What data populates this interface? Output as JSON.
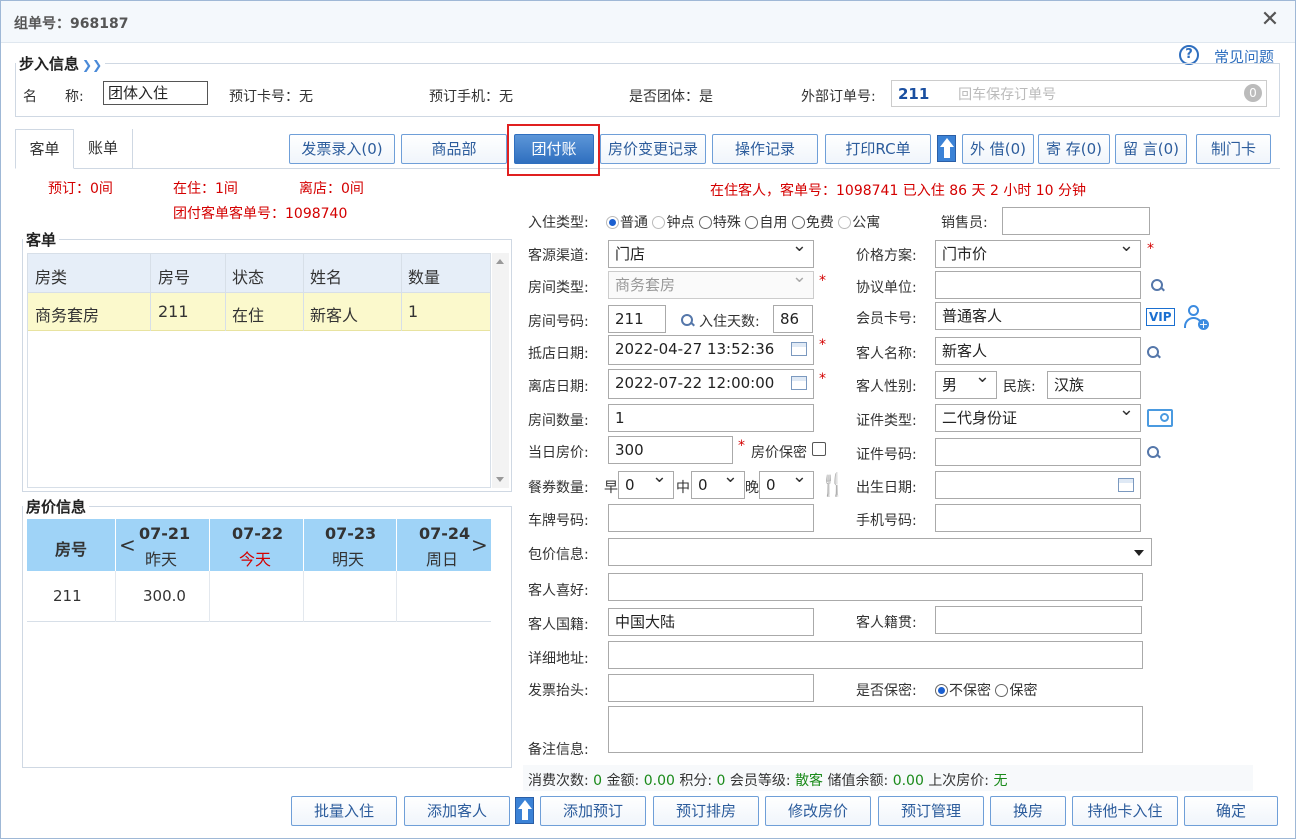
{
  "window": {
    "title": "组单号：968187",
    "close": "✕",
    "faq": "常见问题",
    "faq_icon": "question-icon"
  },
  "step": {
    "legend": "步入信息",
    "name_label": "名　　称:",
    "name_value": "团体入住",
    "card_label": "预订卡号：无",
    "phone_label": "预订手机：无",
    "group_label": "是否团体：是",
    "ext_label": "外部订单号:",
    "ext_value": "211",
    "ext_placeholder": "回车保存订单号",
    "ext_badge": "0"
  },
  "tabs": {
    "guest": "客单",
    "bill": "账单"
  },
  "toolbar": {
    "invoice": "发票录入(0)",
    "goods": "商品部",
    "team_pay": "团付账",
    "price_change": "房价变更记录",
    "op_log": "操作记录",
    "print_rc": "打印RC单",
    "lend": "外 借(0)",
    "store": "寄 存(0)",
    "message": "留 言(0)",
    "make_card": "制门卡"
  },
  "stats": {
    "booked": "预订：0间",
    "staying": "在住：1间",
    "left": "离店：0间",
    "group_no": "团付客单客单号：1098740"
  },
  "status_line": "在住客人，客单号：1098741 已入住 86 天 2 小时 10 分钟",
  "guest_list": {
    "legend": "客单",
    "headers": [
      "房类",
      "房号",
      "状态",
      "姓名",
      "数量"
    ],
    "rows": [
      [
        "商务套房",
        "211",
        "在住",
        "新客人",
        "1"
      ]
    ]
  },
  "price_info": {
    "legend": "房价信息",
    "room_header": "房号",
    "days": [
      {
        "date": "07-21",
        "label": "昨天"
      },
      {
        "date": "07-22",
        "label": "今天"
      },
      {
        "date": "07-23",
        "label": "明天"
      },
      {
        "date": "07-24",
        "label": "周日"
      }
    ],
    "prev": "<",
    "next": ">",
    "rows": [
      {
        "room": "211",
        "prices": [
          "300.0",
          "",
          "",
          ""
        ]
      }
    ]
  },
  "form": {
    "checkin_type_label": "入住类型:",
    "checkin_types": [
      "普通",
      "钟点",
      "特殊",
      "自用",
      "免费",
      "公寓"
    ],
    "salesman_label": "销售员:",
    "salesman": "",
    "source_label": "客源渠道:",
    "source": "门店",
    "price_plan_label": "价格方案:",
    "price_plan": "门市价",
    "room_type_label": "房间类型:",
    "room_type": "商务套房",
    "agreement_label": "协议单位:",
    "agreement": "",
    "room_no_label": "房间号码:",
    "room_no": "211",
    "days_label": "入住天数:",
    "days": "86",
    "member_label": "会员卡号:",
    "member": "普通客人",
    "vip": "VIP",
    "arrive_label": "抵店日期:",
    "arrive": "2022-04-27 13:52:36",
    "guest_name_label": "客人名称:",
    "guest_name": "新客人",
    "depart_label": "离店日期:",
    "depart": "2022-07-22 12:00:00",
    "gender_label": "客人性别:",
    "gender": "男",
    "nation_label": "民族:",
    "nation": "汉族",
    "room_count_label": "房间数量:",
    "room_count": "1",
    "id_type_label": "证件类型:",
    "id_type": "二代身份证",
    "rate_label": "当日房价:",
    "rate": "300",
    "rate_secret": "房价保密",
    "id_no_label": "证件号码:",
    "id_no": "",
    "meal_label": "餐券数量:",
    "meal_b": "早",
    "meal_l": "中",
    "meal_d": "晚",
    "meal_b_val": "0",
    "meal_l_val": "0",
    "meal_d_val": "0",
    "birth_label": "出生日期:",
    "birth": "",
    "plate_label": "车牌号码:",
    "plate": "",
    "phone_label": "手机号码:",
    "phone": "",
    "package_label": "包价信息:",
    "package": "",
    "pref_label": "客人喜好:",
    "pref": "",
    "nationality_label": "客人国籍:",
    "nationality": "中国大陆",
    "origin_label": "客人籍贯:",
    "origin": "",
    "address_label": "详细地址:",
    "address": "",
    "invoice_label": "发票抬头:",
    "invoice": "",
    "secret_label": "是否保密:",
    "secret_opts": [
      "不保密",
      "保密"
    ],
    "remark_label": "备注信息:",
    "remark": ""
  },
  "consume": {
    "count_label": "消费次数:",
    "count": "0",
    "amount_label": "金额:",
    "amount": "0.00",
    "points_label": "积分:",
    "points": "0",
    "level_label": "会员等级:",
    "level": "散客",
    "balance_label": "储值余额:",
    "balance": "0.00",
    "last_label": "上次房价:",
    "last": "无"
  },
  "bottom": {
    "batch": "批量入住",
    "add_guest": "添加客人",
    "add_booking": "添加预订",
    "book_arrange": "预订排房",
    "modify_price": "修改房价",
    "book_manage": "预订管理",
    "change_room": "换房",
    "card_checkin": "持他卡入住",
    "ok": "确定"
  },
  "colors": {
    "accent": "#2f6fbf",
    "red": "#d40000",
    "green": "#1a8a1a",
    "highlight_row": "#fbf9cc",
    "header_bg": "#e6eef8",
    "price_header": "#9fd3f7"
  }
}
